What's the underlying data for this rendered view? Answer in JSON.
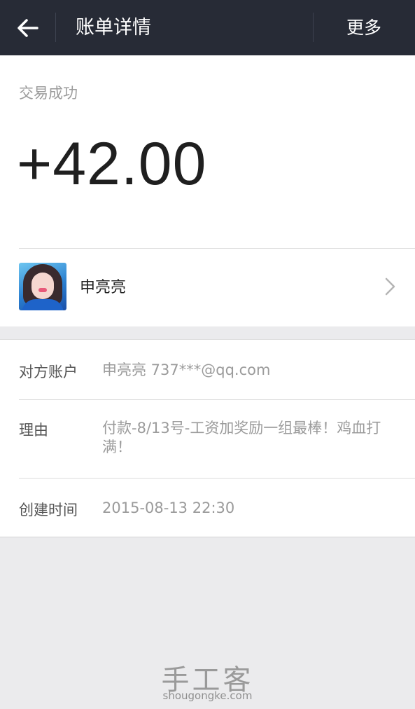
{
  "header": {
    "title": "账单详情",
    "more_label": "更多",
    "back_icon": "arrow-left-icon"
  },
  "summary": {
    "status": "交易成功",
    "amount": "+42.00"
  },
  "payer": {
    "name": "申亮亮",
    "avatar_icon": "avatar-photo",
    "chevron_icon": "chevron-right-icon"
  },
  "details": [
    {
      "label": "对方账户",
      "value": "申亮亮 737***@qq.com"
    },
    {
      "label": "理由",
      "value": "付款-8/13号-工资加奖励一组最棒！鸡血打满！"
    },
    {
      "label": "创建时间",
      "value": "2015-08-13 22:30"
    }
  ],
  "watermark": {
    "title": "手工客",
    "url": "shougongke.com"
  },
  "colors": {
    "topbar_bg": "#272b36",
    "page_bg": "#ebebed",
    "amount_text": "#1f1f1f",
    "muted_text": "#9b9b9b"
  }
}
